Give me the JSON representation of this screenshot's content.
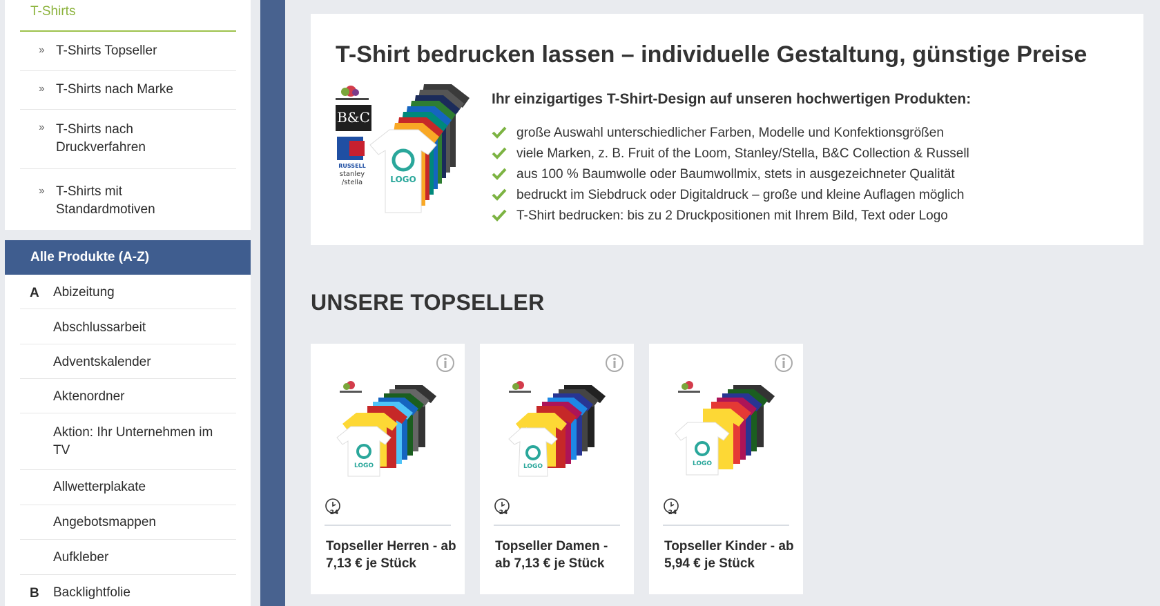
{
  "sidebar": {
    "title": "T-Shirts",
    "sub_items": [
      {
        "label": "T-Shirts Topseller"
      },
      {
        "label": "T-Shirts nach Marke"
      },
      {
        "label": "T-Shirts nach Druckverfahren"
      },
      {
        "label": "T-Shirts mit Standardmotiven"
      }
    ],
    "chevron": "››",
    "alle_header": "Alle Produkte (A-Z)",
    "az_items": [
      {
        "letter": "A",
        "label": "Abizeitung"
      },
      {
        "letter": "",
        "label": "Abschlussarbeit"
      },
      {
        "letter": "",
        "label": "Adventskalender"
      },
      {
        "letter": "",
        "label": "Aktenordner"
      },
      {
        "letter": "",
        "label": "Aktion: Ihr Unternehmen im TV"
      },
      {
        "letter": "",
        "label": "Allwetterplakate"
      },
      {
        "letter": "",
        "label": "Angebotsmappen"
      },
      {
        "letter": "",
        "label": "Aufkleber"
      },
      {
        "letter": "B",
        "label": "Backlightfolie"
      }
    ]
  },
  "intro": {
    "title": "T-Shirt bedrucken lassen – individuelle Gestaltung, günstige Preise",
    "subtitle": "Ihr einzigartiges T-Shirt-Design auf unseren hochwertigen Produkten:",
    "bullets": [
      "große Auswahl unterschiedlicher Farben, Modelle und Konfektionsgrößen",
      "viele Marken, z. B. Fruit of the Loom, Stanley/Stella, B&C Collection & Russell",
      "aus 100 % Baumwolle oder Baumwollmix, stets in ausgezeichneter Qualität",
      "bedruckt im Siebdruck oder Digitaldruck – große und kleine Auflagen möglich",
      "T-Shirt bedrucken: bis zu 2 Druckpositionen mit Ihrem Bild, Text oder Logo"
    ],
    "image_labels": {
      "brand_bc": "B&C",
      "brand_russell": "RUSSELL",
      "brand_stanley": "stanley /stella",
      "logo": "LOGO"
    }
  },
  "topseller": {
    "heading": "UNSERE TOPSELLER",
    "cards": [
      {
        "name": "Topseller Herren - ab 7,13 € je Stück",
        "clock_label": "24"
      },
      {
        "name": "Topseller Damen - ab 7,13 € je Stück",
        "clock_label": "24"
      },
      {
        "name": "Topseller Kinder - ab 5,94 € je Stück",
        "clock_label": "24"
      }
    ]
  },
  "colors": {
    "accent_green": "#8cb33c",
    "header_blue": "#3f5d8f",
    "strip_blue": "#48628f",
    "check_green": "#7cb342"
  }
}
